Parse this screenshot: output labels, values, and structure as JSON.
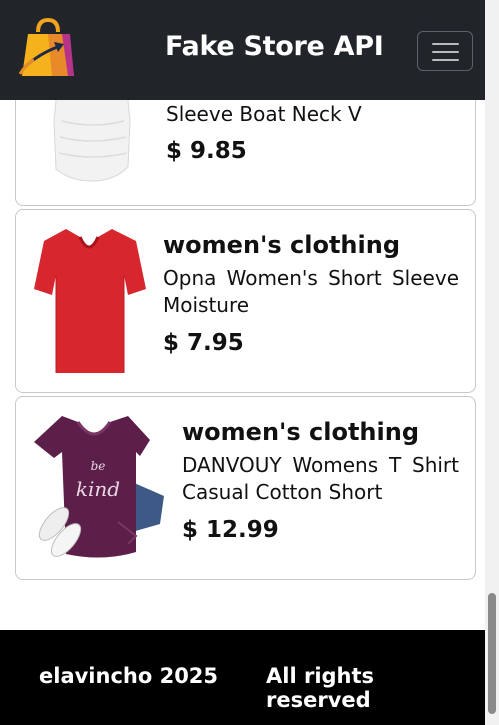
{
  "navbar": {
    "brand": "Fake Store API",
    "logo_icon": "shopping-bag-icon",
    "menu_icon": "hamburger-menu-icon"
  },
  "products": [
    {
      "category": "",
      "title": "Sleeve Boat Neck V",
      "price": "$ 9.85",
      "image": "white-tshirt"
    },
    {
      "category": "women's clothing",
      "title": "Opna Women's Short Sleeve Moisture",
      "price": "$ 7.95",
      "image": "red-vneck-tshirt"
    },
    {
      "category": "women's clothing",
      "title": "DANVOUY Womens T Shirt Casual Cotton Short",
      "price": "$ 12.99",
      "image": "purple-be-kind-tshirt",
      "image_text": "be kind"
    }
  ],
  "footer": {
    "left": "elavincho 2025",
    "right": "All rights reserved"
  },
  "colors": {
    "navbar": "#212529",
    "footer": "#000000",
    "card_border": "#c8c8c8"
  }
}
